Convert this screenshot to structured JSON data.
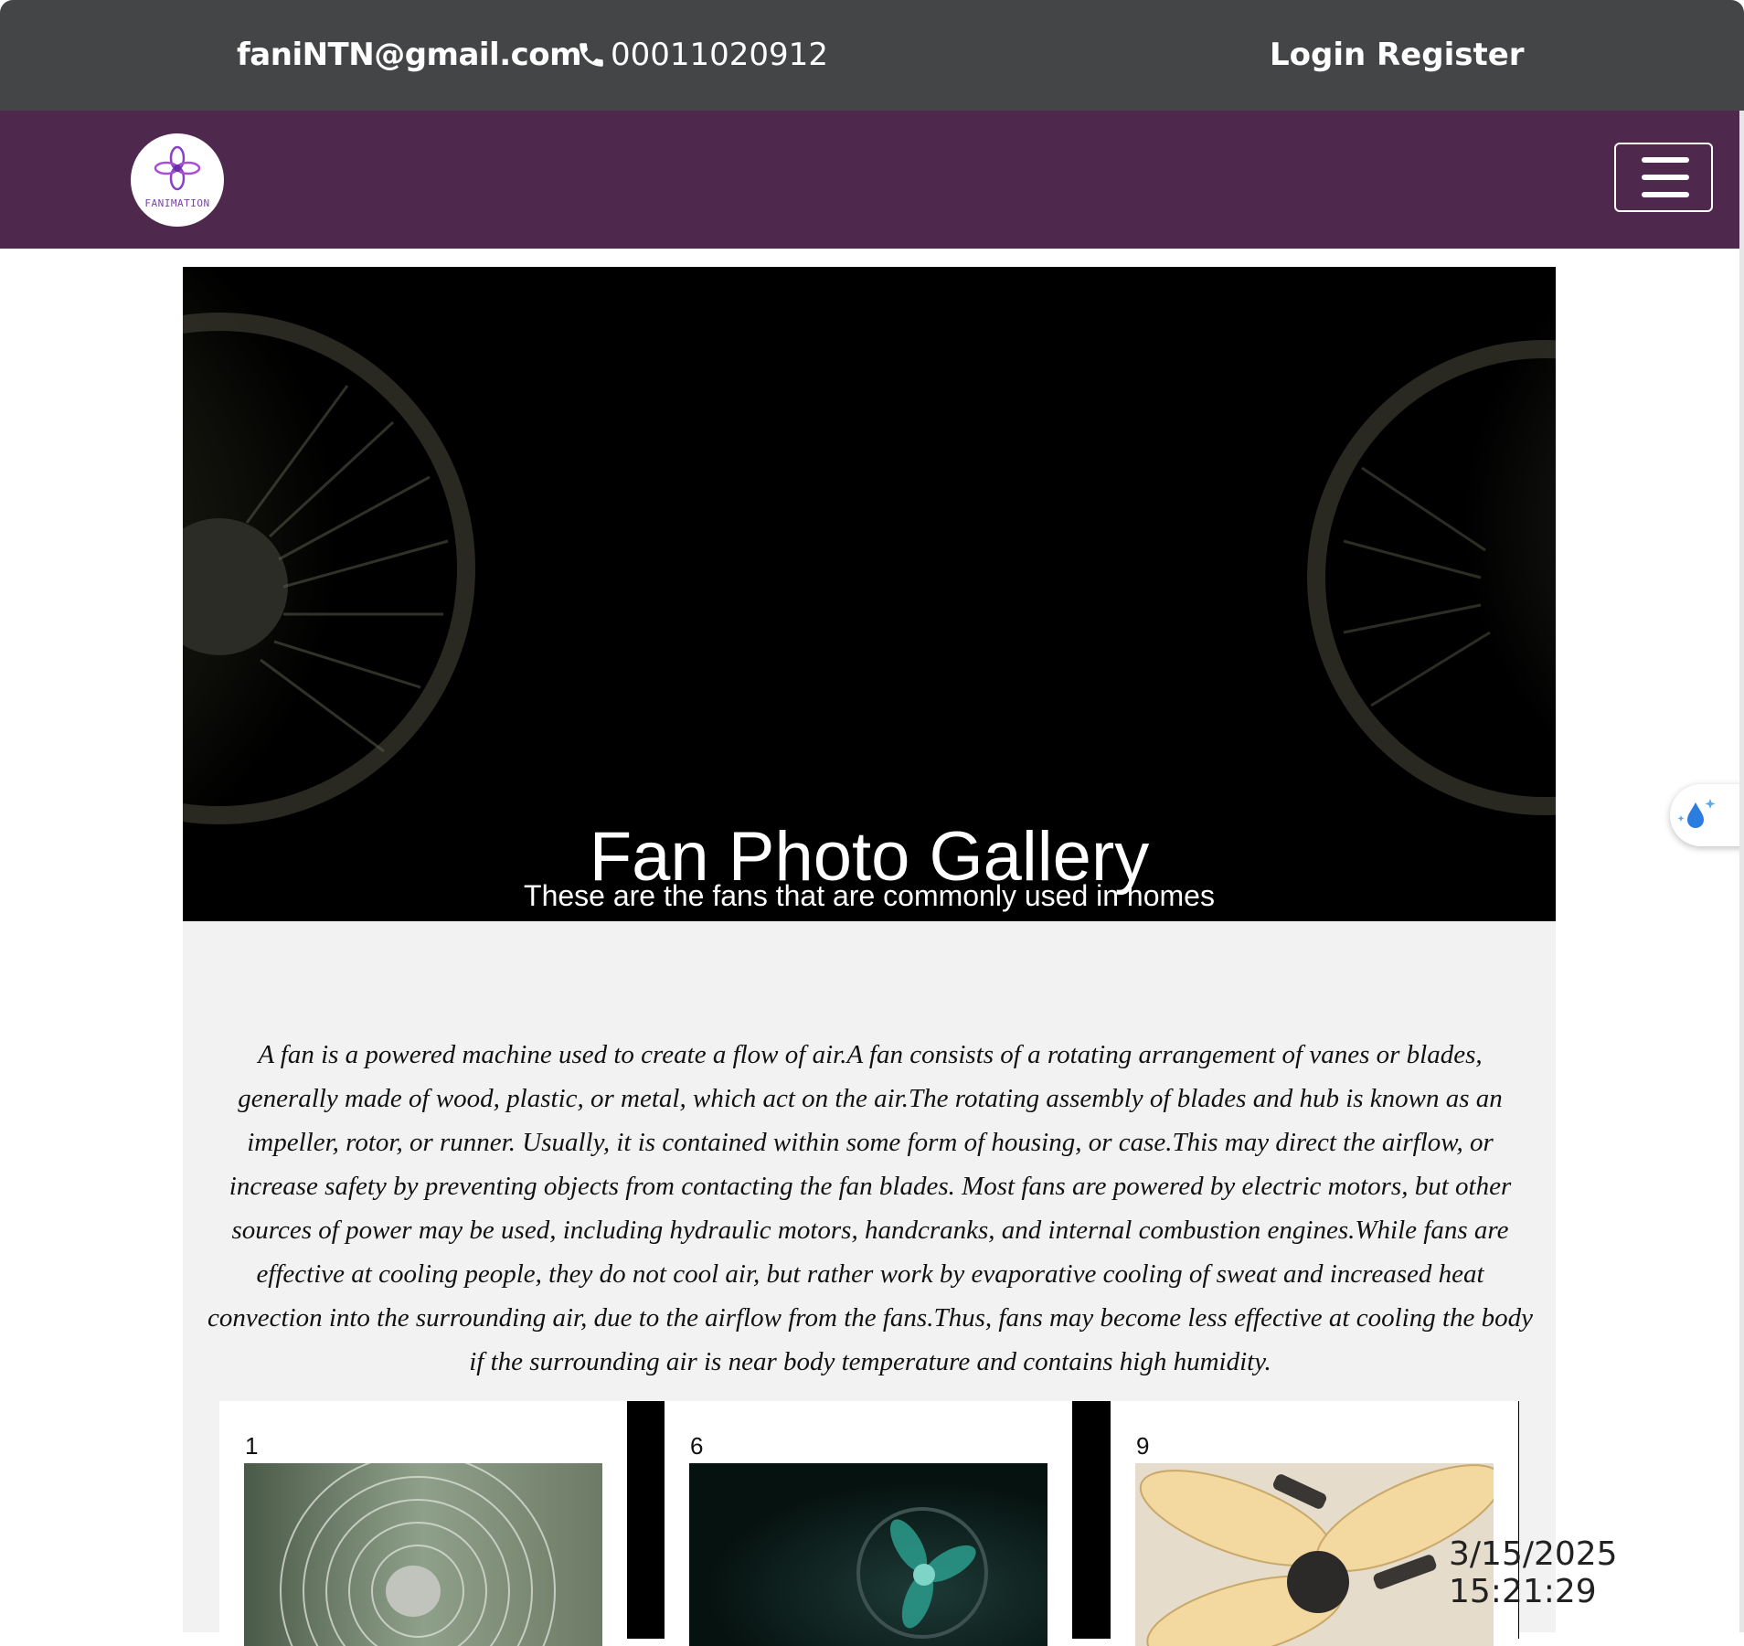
{
  "header": {
    "email": "faniNTN@gmail.com",
    "phone": "00011020912",
    "login_label": "Login",
    "register_label": "Register"
  },
  "navbar": {
    "logo_text": "FANIMATION",
    "menu_icon": "hamburger-icon"
  },
  "hero": {
    "title": "Fan Photo Gallery",
    "subtitle": "These are the fans that are commonly used in homes"
  },
  "description": "A fan is a powered machine used to create a flow of air.A fan consists of a rotating arrangement of vanes or blades, generally made of wood, plastic, or metal, which act on the air.The rotating assembly of blades and hub is known as an impeller, rotor, or runner. Usually, it is contained within some form of housing, or case.This may direct the airflow, or increase safety by preventing objects from contacting the fan blades. Most fans are powered by electric motors, but other sources of power may be used, including hydraulic motors, handcranks, and internal combustion engines.While fans are effective at cooling people, they do not cool air, but rather work by evaporative cooling of sweat and increased heat convection into the surrounding air, due to the airflow from the fans.Thus, fans may become less effective at cooling the body if the surrounding air is near body temperature and contains high humidity.",
  "gallery": {
    "cards": [
      {
        "number": "1",
        "image": "metal-desk-fan-photo"
      },
      {
        "number": "6",
        "image": "teal-table-fan-photo"
      },
      {
        "number": "9",
        "image": "ceiling-fan-photo"
      }
    ]
  },
  "floating_button": {
    "icon": "water-drop-sparkle-icon"
  },
  "clock": "3/15/2025 15:21:29",
  "colors": {
    "topbar": "#444546",
    "navbar": "#4f294d",
    "content_bg": "#f2f2f2"
  }
}
